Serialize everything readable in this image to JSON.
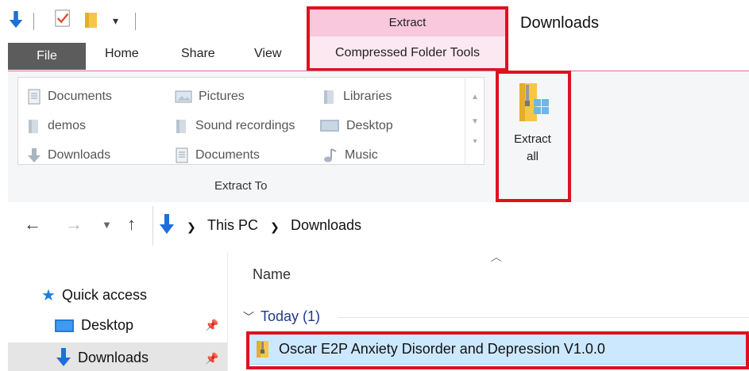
{
  "window": {
    "title": "Downloads"
  },
  "context_tab": {
    "top": "Extract",
    "bottom": "Compressed Folder Tools"
  },
  "tabs": {
    "file": "File",
    "home": "Home",
    "share": "Share",
    "view": "View"
  },
  "ribbon": {
    "gallery": [
      {
        "label": "Documents",
        "icon": "document-icon"
      },
      {
        "label": "Pictures",
        "icon": "pictures-icon"
      },
      {
        "label": "Libraries",
        "icon": "folder-icon"
      },
      {
        "label": "demos",
        "icon": "folder-icon"
      },
      {
        "label": "Sound recordings",
        "icon": "folder-icon"
      },
      {
        "label": "Desktop",
        "icon": "desktop-icon"
      },
      {
        "label": "Downloads",
        "icon": "download-icon"
      },
      {
        "label": "Documents",
        "icon": "document-icon"
      },
      {
        "label": "Music",
        "icon": "music-icon"
      }
    ],
    "group_label": "Extract To",
    "extract_all_line1": "Extract",
    "extract_all_line2": "all"
  },
  "address": {
    "crumb1": "This PC",
    "crumb2": "Downloads"
  },
  "nav_pane": {
    "quick_access": "Quick access",
    "desktop": "Desktop",
    "downloads": "Downloads"
  },
  "content": {
    "column_name": "Name",
    "group_header": "Today (1)",
    "file_name": "Oscar E2P Anxiety Disorder and Depression V1.0.0"
  },
  "colors": {
    "highlight": "#e01020",
    "context_tab": "#f9c8dc",
    "selection": "#cce8ff",
    "accent_blue": "#1e6fd9"
  }
}
